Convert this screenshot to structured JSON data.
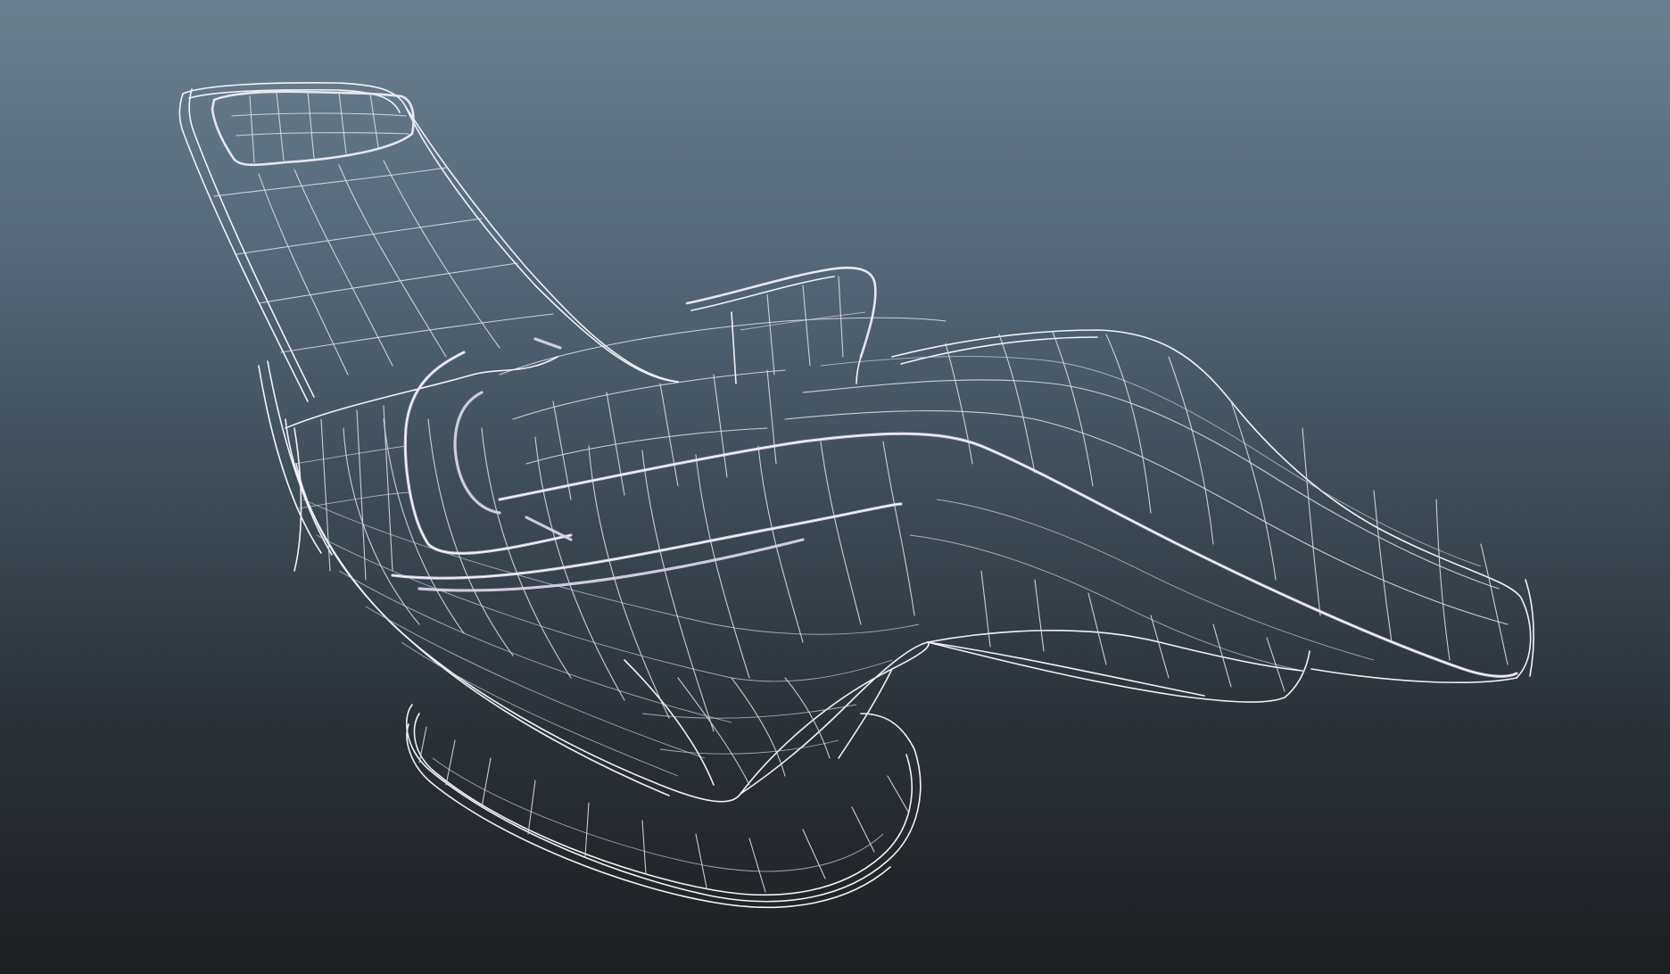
{
  "viewport": {
    "background_top": "#6b7f8e",
    "background_bottom": "#1d1f22",
    "wire_color": "#f2f2f6",
    "trim_color": "#d8d2e6"
  },
  "model": {
    "icon": "lounge-chair-wireframe"
  }
}
